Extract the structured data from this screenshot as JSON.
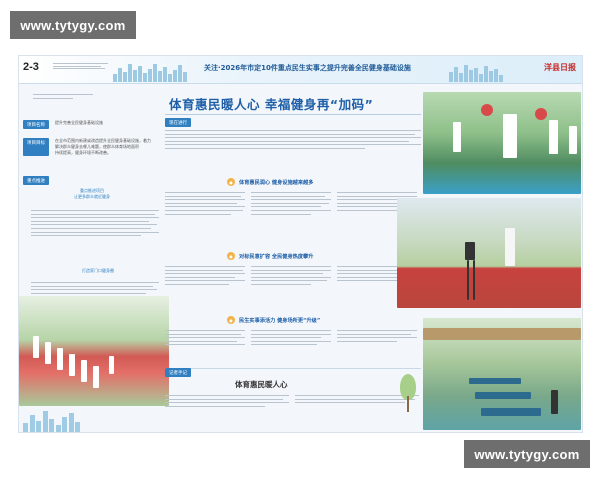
{
  "watermark": {
    "top": "www.tytygy.com",
    "bottom": "www.tytygy.com"
  },
  "masthead": {
    "page_number": "2-3",
    "banner": "关注·2026年市定10件重点民生实事之提升完善全民健身基础设施",
    "brand": "洋县日报"
  },
  "sidebar": {
    "tags": [
      "项目名称",
      "项目目标",
      "重点推进"
    ],
    "project_name": "提升完善全民健身基础设施",
    "target_lines": [
      "在全市范围内新建或改造提升全民健身基础设施，着力",
      "解决群众健身去哪儿难题，使群众体育场地面积",
      "持续提高，健身环境不断改善。"
    ],
    "highlight_lines": [
      "重点推进项目",
      "让更多群众就近健身",
      "打造家门口健身圈"
    ]
  },
  "article": {
    "title": "体育惠民暖人心  幸福健身再“加码”",
    "section_tag": "现在进行",
    "subheads": [
      "体育惠民润心 健身设施越来越多",
      "对标民意扩容 全民健身热度攀升",
      "民生实事添活力 健身场所更“升级”"
    ],
    "editor_tag": "记者手记",
    "bottom_title": "体育惠民暖人心"
  },
  "colors": {
    "accent": "#1f5fa8",
    "tag": "#2f7fc1",
    "highlight": "#f3b34a",
    "brand": "#c62828"
  }
}
